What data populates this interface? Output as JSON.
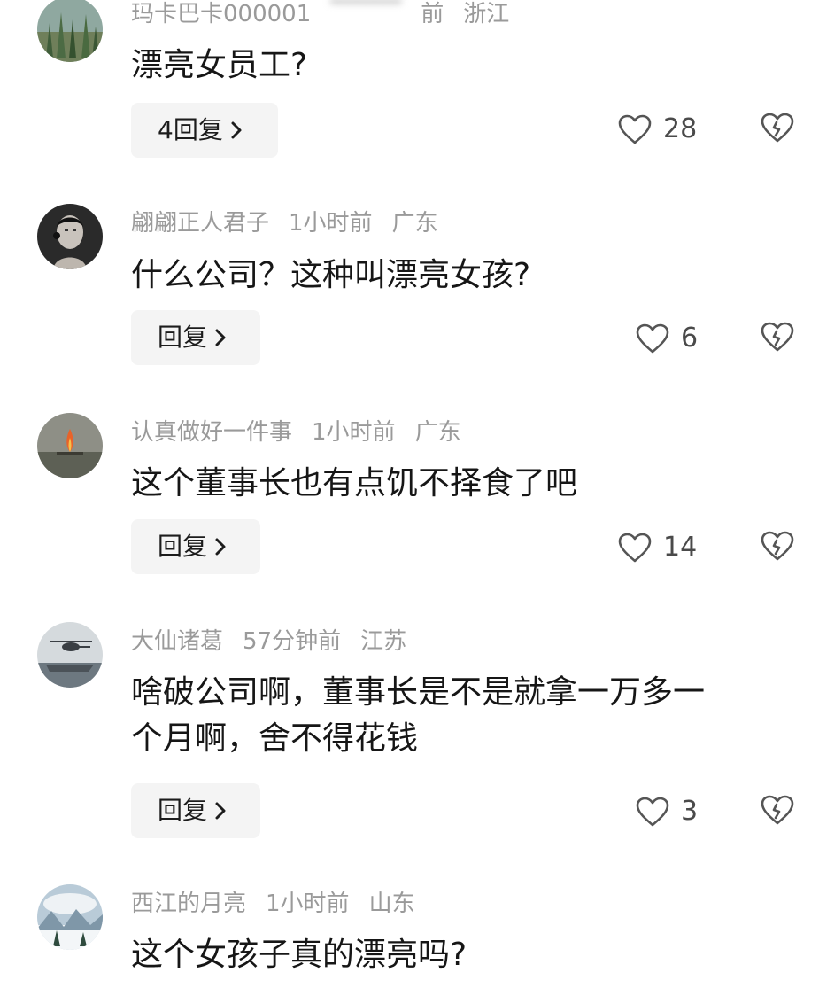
{
  "comments": [
    {
      "username": "玛卡巴卡000001",
      "time_suffix": "前",
      "location": "浙江",
      "text": "漂亮女员工?",
      "reply_label": "4回复",
      "likes": "28",
      "avatar_icon": "cactus-avatar"
    },
    {
      "username": "翩翩正人君子",
      "time": "1小时前",
      "location": "广东",
      "text": "什么公司？这种叫漂亮女孩?",
      "reply_label": "回复",
      "likes": "6",
      "avatar_icon": "man-avatar"
    },
    {
      "username": "认真做好一件事",
      "time": "1小时前",
      "location": "广东",
      "text": "这个董事长也有点饥不择食了吧",
      "reply_label": "回复",
      "likes": "14",
      "avatar_icon": "flame-avatar"
    },
    {
      "username": "大仙诸葛",
      "time": "57分钟前",
      "location": "江苏",
      "text_line1": "啥破公司啊，董事长是不是就拿一万多一",
      "text_line2": "个月啊，舍不得花钱",
      "reply_label": "回复",
      "likes": "3",
      "avatar_icon": "helicopter-avatar"
    },
    {
      "username": "西江的月亮",
      "time": "1小时前",
      "location": "山东",
      "text": "这个女孩子真的漂亮吗?",
      "avatar_icon": "snow-landscape-avatar"
    }
  ],
  "colors": {
    "username": "#9a9a9a",
    "text": "#161616",
    "reply_bg": "#f4f4f4",
    "icon": "#555555"
  }
}
